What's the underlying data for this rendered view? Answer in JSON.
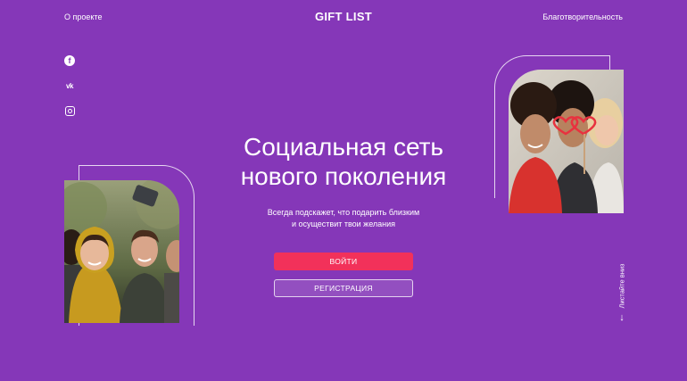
{
  "header": {
    "about": "О проекте",
    "logo": "GIFT LIST",
    "charity": "Благотворительность"
  },
  "social": {
    "facebook_icon": "facebook-icon",
    "vk_icon": "vk-icon",
    "instagram_icon": "instagram-icon",
    "vk_glyph": "vk"
  },
  "hero": {
    "title_line1": "Социальная сеть",
    "title_line2": "нового поколения",
    "subtitle_line1": "Всегда подскажет, что подарить близким",
    "subtitle_line2": "и осуществит твои желания",
    "login": "ВОЙТИ",
    "register": "РЕГИСТРАЦИЯ"
  },
  "scroll": {
    "label": "Листайте вниз",
    "arrow": "↓"
  },
  "colors": {
    "background": "#8537b8",
    "primary_button": "#f2315a",
    "text": "#ffffff"
  }
}
